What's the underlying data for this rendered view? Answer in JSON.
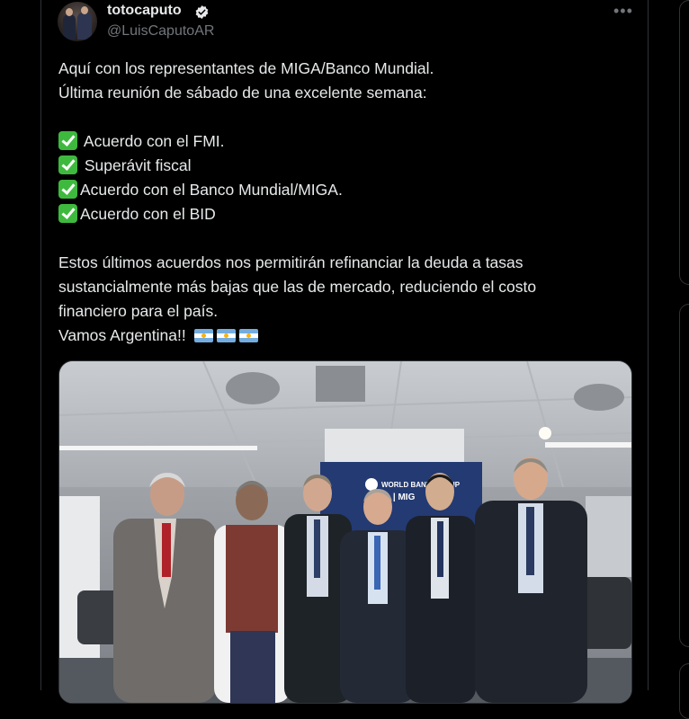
{
  "author": {
    "display_name": "totocaputo",
    "handle": "@LuisCaputoAR",
    "verified": true
  },
  "more_icon": "more-horizontal-icon",
  "text": {
    "intro1": "Aquí con los representantes de MIGA/Banco Mundial.",
    "intro2": "Última reunión de sábado de una excelente semana:",
    "items": [
      " Acuerdo con el FMI.",
      " Superávit fiscal",
      "Acuerdo con el Banco Mundial/MIGA.",
      "Acuerdo con el BID"
    ],
    "body1": "Estos últimos acuerdos nos permitirán refinanciar la deuda a tasas",
    "body2": "sustancialmente más bajas que las de mercado, reduciendo el costo",
    "body3": "financiero para el país.",
    "closing": "Vamos Argentina!!"
  },
  "photo": {
    "banner_line1": "WORLD BANK GROUP",
    "banner_line2": "ntees | MIG"
  },
  "colors": {
    "background": "#000000",
    "text": "#e7e9ea",
    "muted": "#71767b",
    "verified_badge": "#e7e9ea",
    "check": "#3eb93e"
  }
}
